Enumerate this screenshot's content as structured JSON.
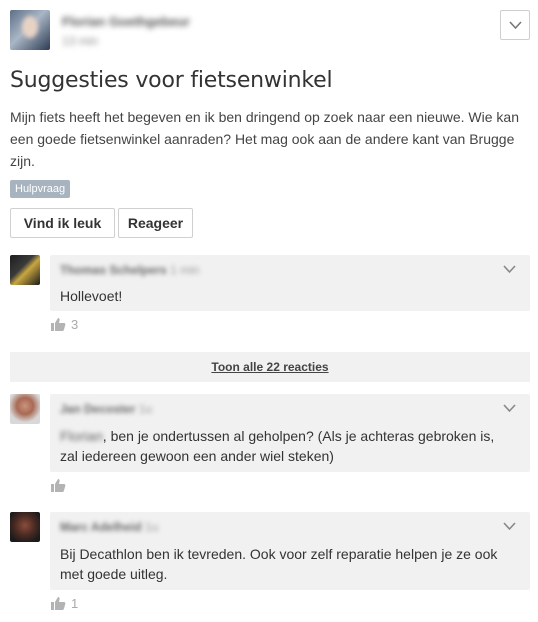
{
  "post": {
    "author": "Florian Goethgebeur",
    "time": "13 min",
    "title": "Suggesties voor fietsenwinkel",
    "body": "Mijn fiets heeft het begeven en ik ben dringend op zoek naar een nieuwe. Wie kan een goede fietsenwinkel aanraden? Het mag ook aan de andere kant van Brugge zijn.",
    "tag": "Hulpvraag",
    "like_label": "Vind ik leuk",
    "reply_label": "Reageer"
  },
  "comments": [
    {
      "author": "Thomas Schelpers",
      "time": "1 min",
      "mention": "",
      "text": "Hollevoet!",
      "likes": "3"
    },
    {
      "author": "Jan Decoster",
      "time": "1u",
      "mention": "Florian",
      "text": ", ben je ondertussen al geholpen? (Als je achteras gebroken is, zal iedereen gewoon een ander wiel steken)",
      "likes": ""
    },
    {
      "author": "Marc Adelheid",
      "time": "1u",
      "mention": "",
      "text": "Bij Decathlon ben ik tevreden. Ook voor zelf reparatie helpen je ze ook met goede uitleg.",
      "likes": "1"
    }
  ],
  "show_all_label": "Toon alle 22 reacties",
  "icons": {
    "menu": "chevron-down-icon",
    "like": "thumbs-up-icon"
  },
  "colors": {
    "tag_bg": "#a7b3be",
    "bubble_bg": "#f1f1f1"
  }
}
